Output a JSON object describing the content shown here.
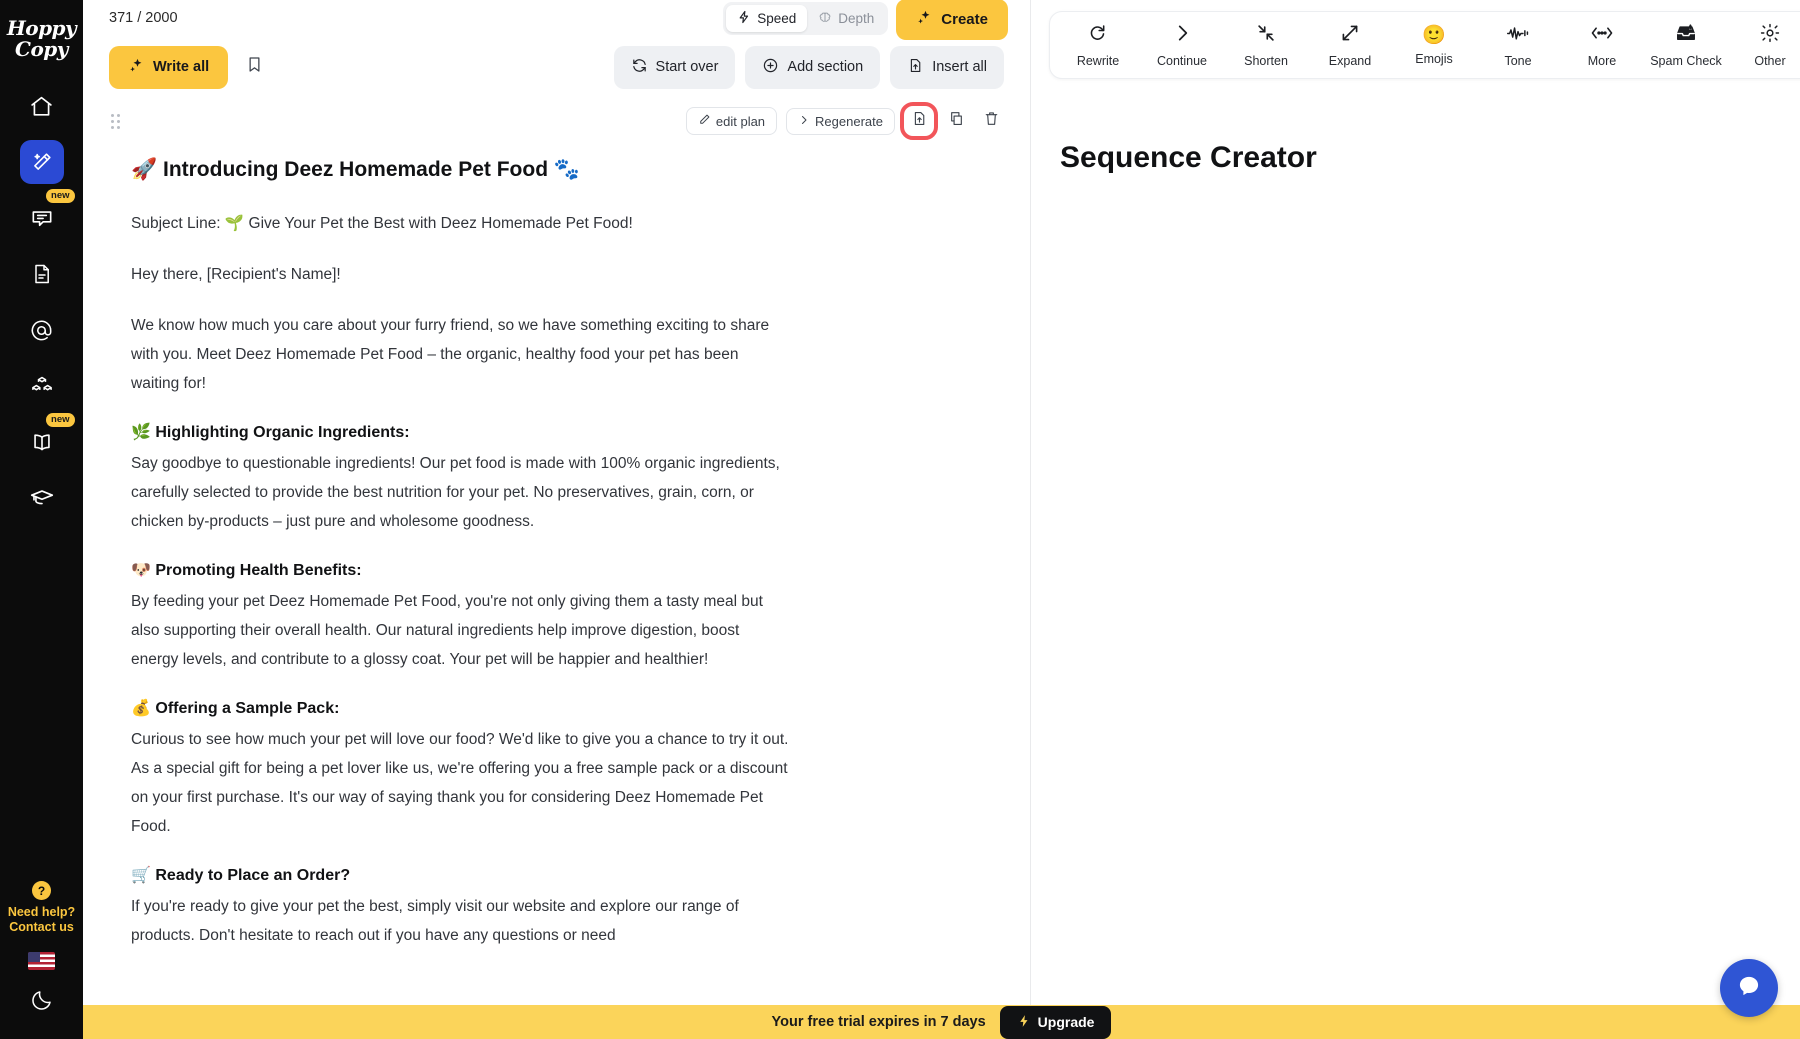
{
  "rail": {
    "brand_line1": "Hoppy",
    "brand_line2": "Copy",
    "items": [
      {
        "name": "home",
        "icon": "home-icon",
        "badge": ""
      },
      {
        "name": "write",
        "icon": "magic-wand-icon",
        "badge": ""
      },
      {
        "name": "chat",
        "icon": "chat-bubble-icon",
        "badge": "new"
      },
      {
        "name": "documents",
        "icon": "document-icon",
        "badge": ""
      },
      {
        "name": "email",
        "icon": "at-sign-icon",
        "badge": ""
      },
      {
        "name": "blocks",
        "icon": "blocks-icon",
        "badge": ""
      },
      {
        "name": "library",
        "icon": "open-book-icon",
        "badge": "new"
      },
      {
        "name": "academy",
        "icon": "graduation-cap-icon",
        "badge": ""
      }
    ],
    "help_symbol": "?",
    "help_line1": "Need help?",
    "help_line2": "Contact us",
    "locale_icon": "us-flag-icon",
    "theme_icon": "moon-icon"
  },
  "topbar": {
    "char_count": "371 / 2000",
    "modes": [
      {
        "label": "Speed",
        "icon": "lightning-icon",
        "active": true
      },
      {
        "label": "Depth",
        "icon": "brain-icon",
        "active": false
      }
    ],
    "create_label": "Create",
    "create_icon": "sparkles-icon",
    "create_color": "#fbc63f"
  },
  "actionbar": {
    "write_all_label": "Write all",
    "write_all_icon": "sparkles-icon",
    "bookmark_icon": "bookmark-icon",
    "buttons": [
      {
        "label": "Start over",
        "icon": "refresh-icon"
      },
      {
        "label": "Add section",
        "icon": "plus-circle-icon"
      },
      {
        "label": "Insert all",
        "icon": "file-upload-icon"
      }
    ]
  },
  "card": {
    "drag_handle_icon": "drag-dots-icon",
    "edit_plan_label": "edit plan",
    "edit_plan_icon": "pencil-icon",
    "regenerate_label": "Regenerate",
    "regenerate_icon": "chevron-right-icon",
    "insert_icon": "file-insert-icon",
    "copy_icon": "copy-icon",
    "delete_icon": "trash-icon",
    "highlight_color": "#f2555a"
  },
  "document": {
    "title": "🚀 Introducing Deez Homemade Pet Food 🐾",
    "subject_line": "Subject Line: 🌱 Give Your Pet the Best with Deez Homemade Pet Food!",
    "greeting": "Hey there, [Recipient's Name]!",
    "intro": "We know how much you care about your furry friend, so we have something exciting to share with you. Meet Deez Homemade Pet Food – the organic, healthy food your pet has been waiting for!",
    "sections": [
      {
        "heading": "🌿 Highlighting Organic Ingredients:",
        "body": "Say goodbye to questionable ingredients! Our pet food is made with 100% organic ingredients, carefully selected to provide the best nutrition for your pet. No preservatives, grain, corn, or chicken by-products – just pure and wholesome goodness."
      },
      {
        "heading": "🐶 Promoting Health Benefits:",
        "body": "By feeding your pet Deez Homemade Pet Food, you're not only giving them a tasty meal but also supporting their overall health. Our natural ingredients help improve digestion, boost energy levels, and contribute to a glossy coat. Your pet will be happier and healthier!"
      },
      {
        "heading": "💰 Offering a Sample Pack:",
        "body": "Curious to see how much your pet will love our food? We'd like to give you a chance to try it out. As a special gift for being a pet lover like us, we're offering you a free sample pack or a discount on your first purchase. It's our way of saying thank you for considering Deez Homemade Pet Food."
      },
      {
        "heading": "🛒 Ready to Place an Order?",
        "body": "If you're ready to give your pet the best, simply visit our website and explore our range of products. Don't hesitate to reach out if you have any questions or need"
      }
    ]
  },
  "right_panel": {
    "title": "Sequence Creator",
    "tools": [
      {
        "label": "Rewrite",
        "icon": "refresh-ccw-icon"
      },
      {
        "label": "Continue",
        "icon": "chevron-right-icon"
      },
      {
        "label": "Shorten",
        "icon": "arrows-in-icon"
      },
      {
        "label": "Expand",
        "icon": "arrows-out-icon"
      },
      {
        "label": "Emojis",
        "icon": "smiley-emoji-icon"
      },
      {
        "label": "Tone",
        "icon": "waveform-icon"
      },
      {
        "label": "More",
        "icon": "ellipsis-arrows-icon"
      },
      {
        "label": "Spam Check",
        "icon": "inbox-warning-icon"
      },
      {
        "label": "Other",
        "icon": "gear-icon"
      }
    ],
    "status_icon": "check-icon",
    "status_color": "#34c759"
  },
  "banner": {
    "message": "Your free trial expires in 7 days",
    "upgrade_label": "Upgrade",
    "upgrade_icon": "lightning-icon",
    "background": "#fbd45a"
  },
  "chat_widget": {
    "icon": "chat-bubble-icon",
    "color": "#2f55d4"
  }
}
